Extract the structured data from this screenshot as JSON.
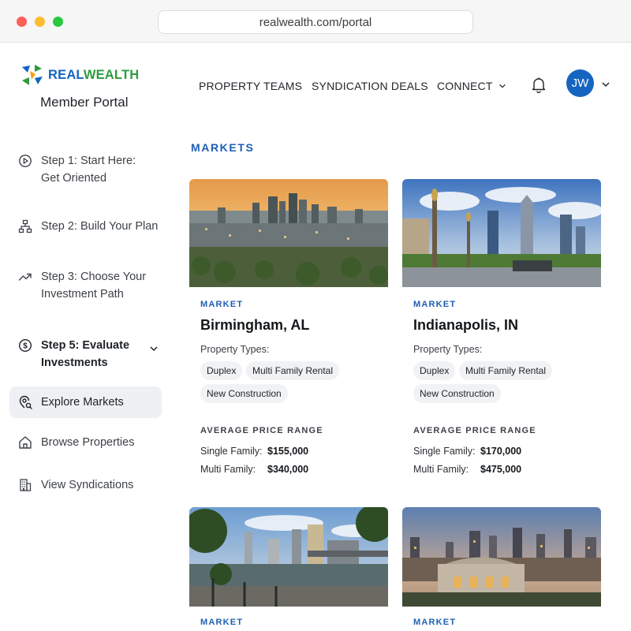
{
  "browser": {
    "url": "realwealth.com/portal"
  },
  "brand": {
    "logo_real": "REAL",
    "logo_wealth": "WEALTH",
    "portal_title": "Member Portal"
  },
  "sidebar": {
    "items": [
      {
        "label": "Step 1: Start Here: Get Oriented",
        "icon": "play-circle-icon"
      },
      {
        "label": "Step 2: Build Your Plan",
        "icon": "org-chart-icon"
      },
      {
        "label": "Step 3: Choose Your Investment Path",
        "icon": "trend-up-icon"
      },
      {
        "label": "Step 5: Evaluate Investments",
        "icon": "dollar-circle-icon"
      },
      {
        "label": "Explore Markets",
        "icon": "map-search-icon"
      },
      {
        "label": "Browse Properties",
        "icon": "home-icon"
      },
      {
        "label": "View Syndications",
        "icon": "building-icon"
      }
    ]
  },
  "topnav": {
    "links": [
      "PROPERTY TEAMS",
      "SYNDICATION DEALS",
      "CONNECT"
    ],
    "avatar_initials": "JW"
  },
  "section_title": "MARKETS",
  "cards": [
    {
      "kicker": "MARKET",
      "city": "Birmingham, AL",
      "property_types_label": "Property Types:",
      "types": [
        "Duplex",
        "Multi Family Rental",
        "New Construction"
      ],
      "price_label": "AVERAGE PRICE RANGE",
      "single_label": "Single Family:",
      "single_value": "$155,000",
      "multi_label": "Multi Family:",
      "multi_value": "$340,000"
    },
    {
      "kicker": "MARKET",
      "city": "Indianapolis, IN",
      "property_types_label": "Property Types:",
      "types": [
        "Duplex",
        "Multi Family Rental",
        "New Construction"
      ],
      "price_label": "AVERAGE PRICE RANGE",
      "single_label": "Single Family:",
      "single_value": "$170,000",
      "multi_label": "Multi Family:",
      "multi_value": "$475,000"
    },
    {
      "kicker": "MARKET"
    },
    {
      "kicker": "MARKET"
    }
  ],
  "colors": {
    "accent": "#1f5fb4",
    "avatar": "#1565c0",
    "logo_green": "#2e9b3f",
    "active_bg": "#eef0f3"
  }
}
